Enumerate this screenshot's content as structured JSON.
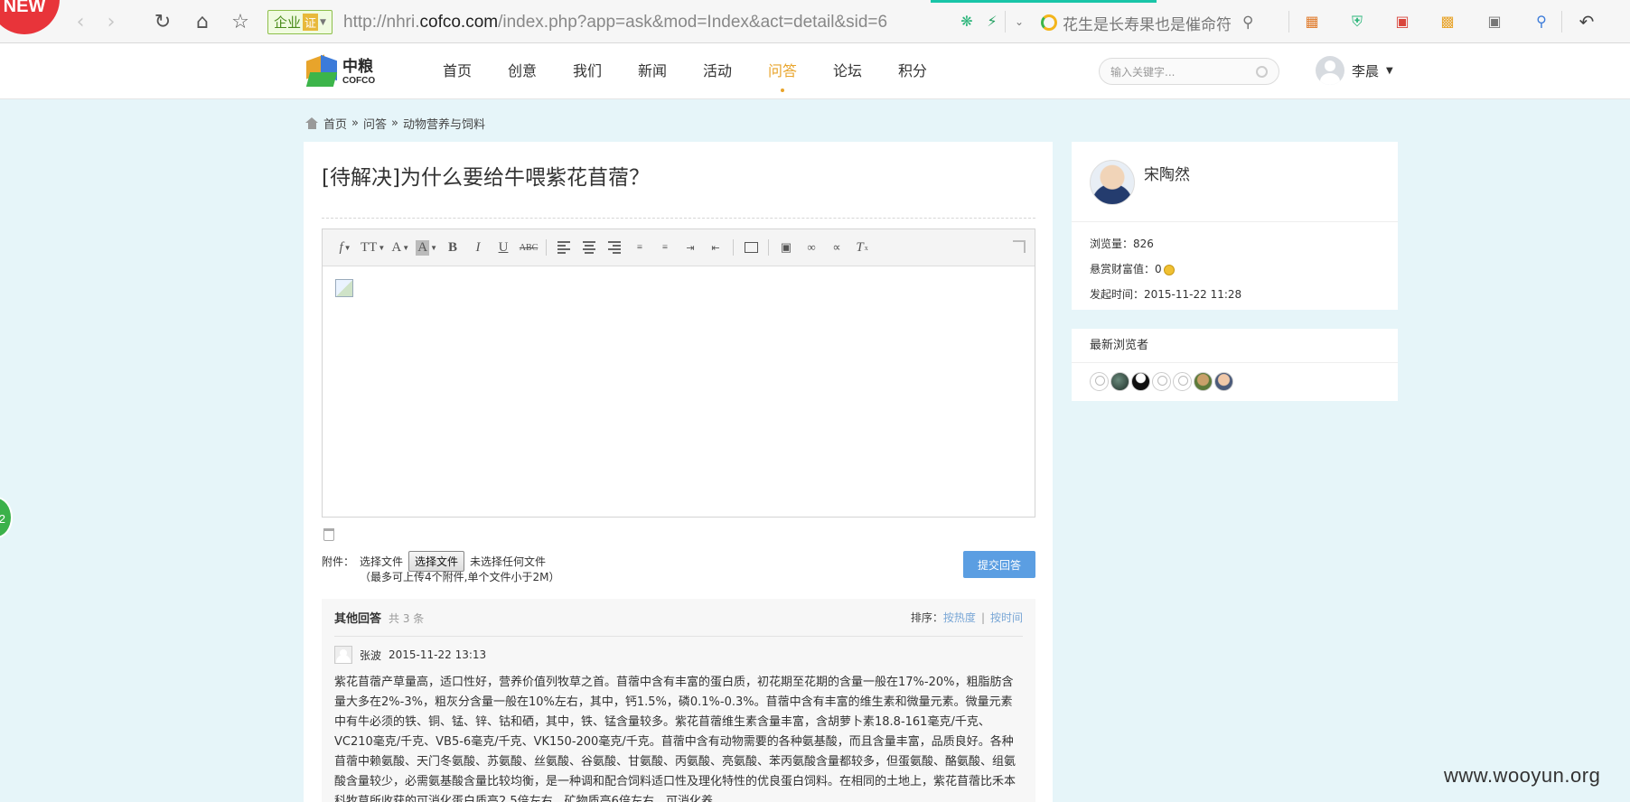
{
  "browser": {
    "badge": "NEW",
    "enterprise_label": "企业",
    "enterprise_cert": "证",
    "url_prefix": "http://nhri.",
    "url_host": "cofco.com",
    "url_path": "/index.php?app=ask&mod=Index&act=detail&sid=6",
    "search_text": "花生是长寿果也是催命符"
  },
  "site": {
    "logo_cn": "中粮",
    "logo_en": "COFCO",
    "nav": [
      "首页",
      "创意",
      "我们",
      "新闻",
      "活动",
      "问答",
      "论坛",
      "积分"
    ],
    "active_nav": "问答",
    "search_placeholder": "输入关键字...",
    "user_name": "李晨"
  },
  "breadcrumb": {
    "items": [
      "首页",
      "问答",
      "动物营养与饲料"
    ],
    "separator": "»"
  },
  "question": {
    "title": "[待解决]为什么要给牛喂紫花苜蓿？"
  },
  "attachment": {
    "label": "附件：",
    "choose_text": "选择文件",
    "button_label": "选择文件",
    "no_file": "未选择任何文件",
    "hint": "（最多可上传4个附件,单个文件小于2M）"
  },
  "submit_label": "提交回答",
  "answers": {
    "heading": "其他回答",
    "count_text": "共 3 条",
    "sort_label": "排序：",
    "sort_options": [
      "按热度",
      "按时间"
    ],
    "first": {
      "author": "张波",
      "time": "2015-11-22 13:13",
      "body": "紫花苜蓿产草量高，适口性好，营养价值列牧草之首。苜蓿中含有丰富的蛋白质，初花期至花期的含量一般在17%-20%，粗脂肪含量大多在2%-3%，粗灰分含量一般在10%左右，其中，钙1.5%，磷0.1%-0.3%。苜蓿中含有丰富的维生素和微量元素。微量元素中有牛必须的铁、铜、锰、锌、钴和硒，其中，铁、锰含量较多。紫花苜蓿维生素含量丰富，含胡萝卜素18.8-161毫克/千克、VC210毫克/千克、VB5-6毫克/千克、VK150-200毫克/千克。苜蓿中含有动物需要的各种氨基酸，而且含量丰富，品质良好。各种苜蓿中赖氨酸、天门冬氨酸、苏氨酸、丝氨酸、谷氨酸、甘氨酸、丙氨酸、亮氨酸、苯丙氨酸含量都较多，但蛋氨酸、酪氨酸、组氨酸含量较少，必需氨基酸含量比较均衡，是一种调和配合饲料适口性及理化特性的优良蛋白饲料。在相同的土地上，紫花苜蓿比禾本科牧草所收获的可消化蛋白质高2.5倍左右，矿物质高6倍左右，可消化养"
    }
  },
  "author": {
    "name": "宋陶然",
    "views_label": "浏览量：",
    "views": "826",
    "reward_label": "悬赏财富值：",
    "reward": "0",
    "created_label": "发起时间：",
    "created": "2015-11-22 11:28"
  },
  "viewers": {
    "heading": "最新浏览者",
    "avatars": [
      "blank",
      "dark",
      "black",
      "blank",
      "blank",
      "green",
      "face"
    ]
  },
  "overlays": {
    "side_badge": "2",
    "watermark": "www.wooyun.org"
  },
  "colors": {
    "nav_active": "#e8a42b",
    "submit": "#5b9ee2",
    "page_bg": "#e6f5f9",
    "link": "#7aa7d6"
  }
}
